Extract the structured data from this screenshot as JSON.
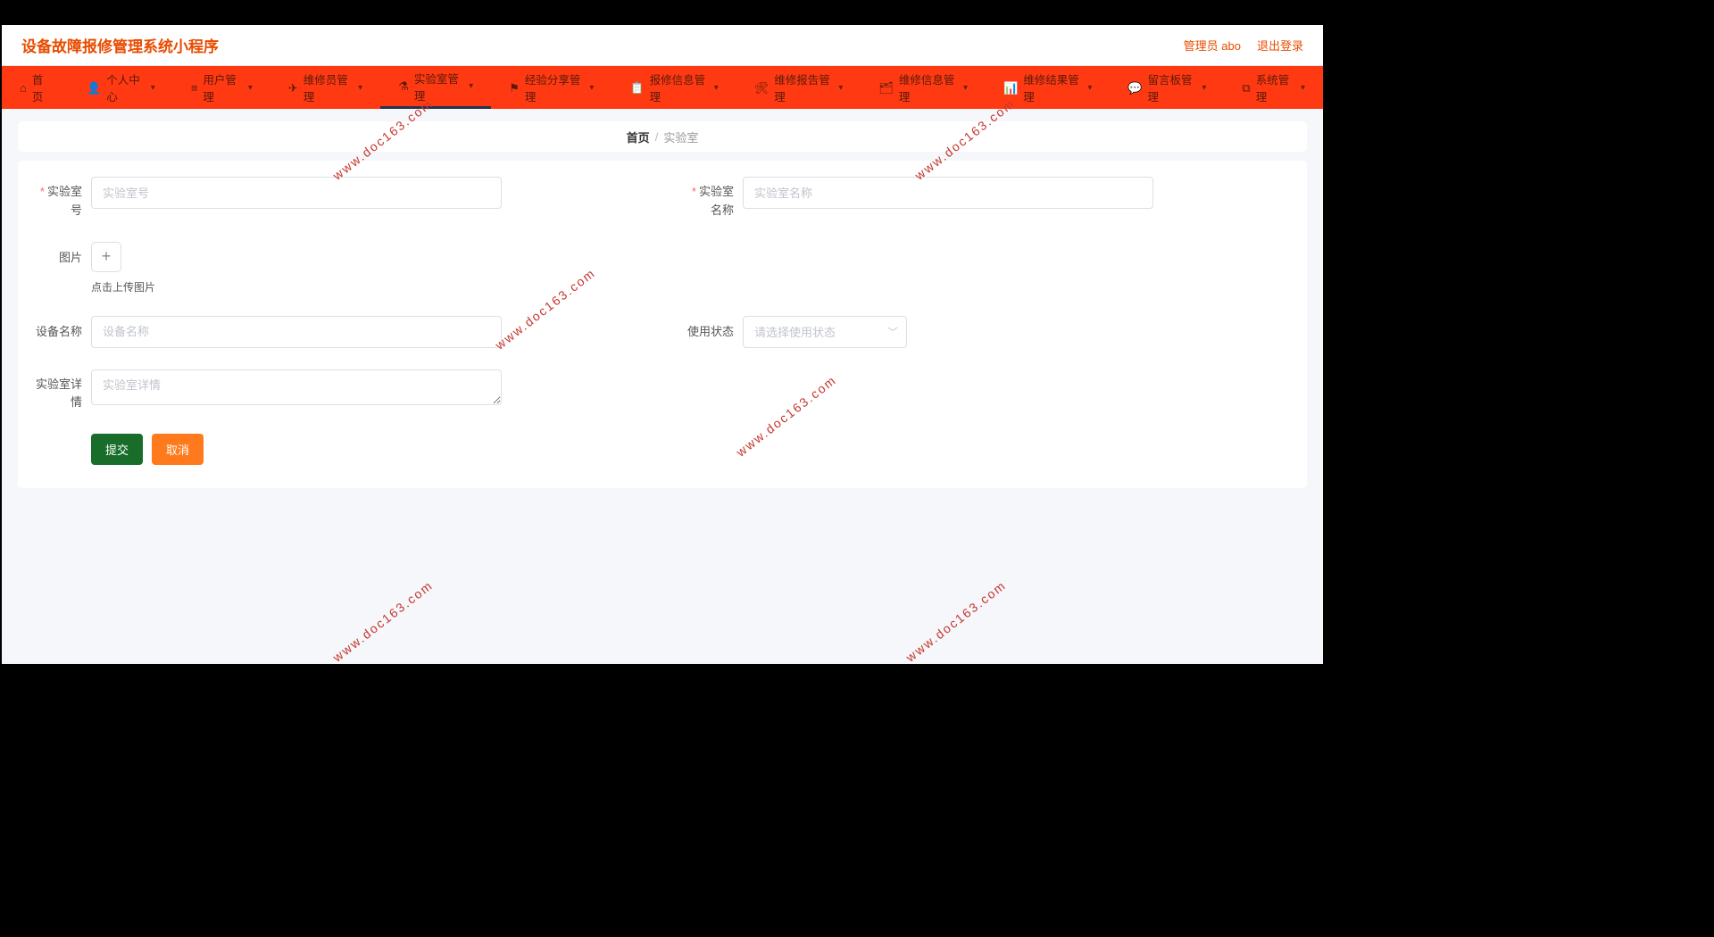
{
  "header": {
    "title": "设备故障报修管理系统小程序",
    "admin": "管理员 abo",
    "logout": "退出登录"
  },
  "nav": [
    {
      "icon": "⌂",
      "label": "首页",
      "caret": false
    },
    {
      "icon": "👤",
      "label": "个人中心",
      "caret": true
    },
    {
      "icon": "≡",
      "label": "用户管理",
      "caret": true
    },
    {
      "icon": "✈",
      "label": "维修员管理",
      "caret": true
    },
    {
      "icon": "⚗",
      "label": "实验室管理",
      "caret": true,
      "active": true
    },
    {
      "icon": "⚑",
      "label": "经验分享管理",
      "caret": true
    },
    {
      "icon": "📋",
      "label": "报修信息管理",
      "caret": true
    },
    {
      "icon": "🛠",
      "label": "维修报告管理",
      "caret": true
    },
    {
      "icon": "🗂",
      "label": "维修信息管理",
      "caret": true
    },
    {
      "icon": "📊",
      "label": "维修结果管理",
      "caret": true
    },
    {
      "icon": "💬",
      "label": "留言板管理",
      "caret": true
    },
    {
      "icon": "⧉",
      "label": "系统管理",
      "caret": true
    }
  ],
  "breadcrumb": {
    "home": "首页",
    "sep": "/",
    "current": "实验室"
  },
  "form": {
    "labNo": {
      "label": "实验室号",
      "placeholder": "实验室号"
    },
    "labName": {
      "label": "实验室名称",
      "placeholder": "实验室名称"
    },
    "image": {
      "label": "图片",
      "btn": "+",
      "tip": "点击上传图片"
    },
    "deviceName": {
      "label": "设备名称",
      "placeholder": "设备名称"
    },
    "useStatus": {
      "label": "使用状态",
      "placeholder": "请选择使用状态"
    },
    "labDetail": {
      "label": "实验室详情",
      "placeholder": "实验室详情"
    },
    "submit": "提交",
    "cancel": "取消"
  },
  "watermark": "www.doc163.com"
}
